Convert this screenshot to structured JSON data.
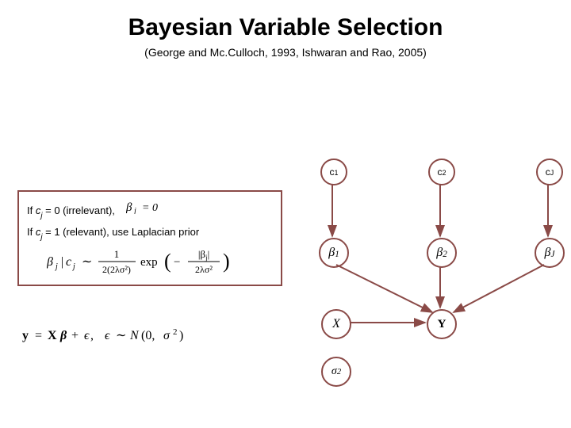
{
  "title": "Bayesian Variable Selection",
  "subtitle": "(George and Mc.Culloch, 1993, Ishwaran and Rao, 2005)",
  "rules": {
    "line1_prefix": "If ",
    "line1_var": "c",
    "line1_sub": "j",
    "line1_rest": " = 0 (irrelevant),",
    "line1_eq": "βⱼ = 0",
    "line2_prefix": "If ",
    "line2_var": "c",
    "line2_sub": "j",
    "line2_rest": " = 1 (relevant), use Laplacian prior"
  },
  "model_eq": "y = Xβ + ϵ,   ϵ ∼ N(0, σ²)",
  "nodes": {
    "c1": "c",
    "c1_sub": "1",
    "c2": "c",
    "c2_sub": "2",
    "cJ": "c",
    "cJ_sub": "J",
    "b1": "β",
    "b1_sub": "1",
    "b2": "β",
    "b2_sub": "2",
    "bJ": "β",
    "bJ_sub": "J",
    "X": "X",
    "Y": "Y",
    "sigma": "σ",
    "sigma_sup": "2"
  }
}
